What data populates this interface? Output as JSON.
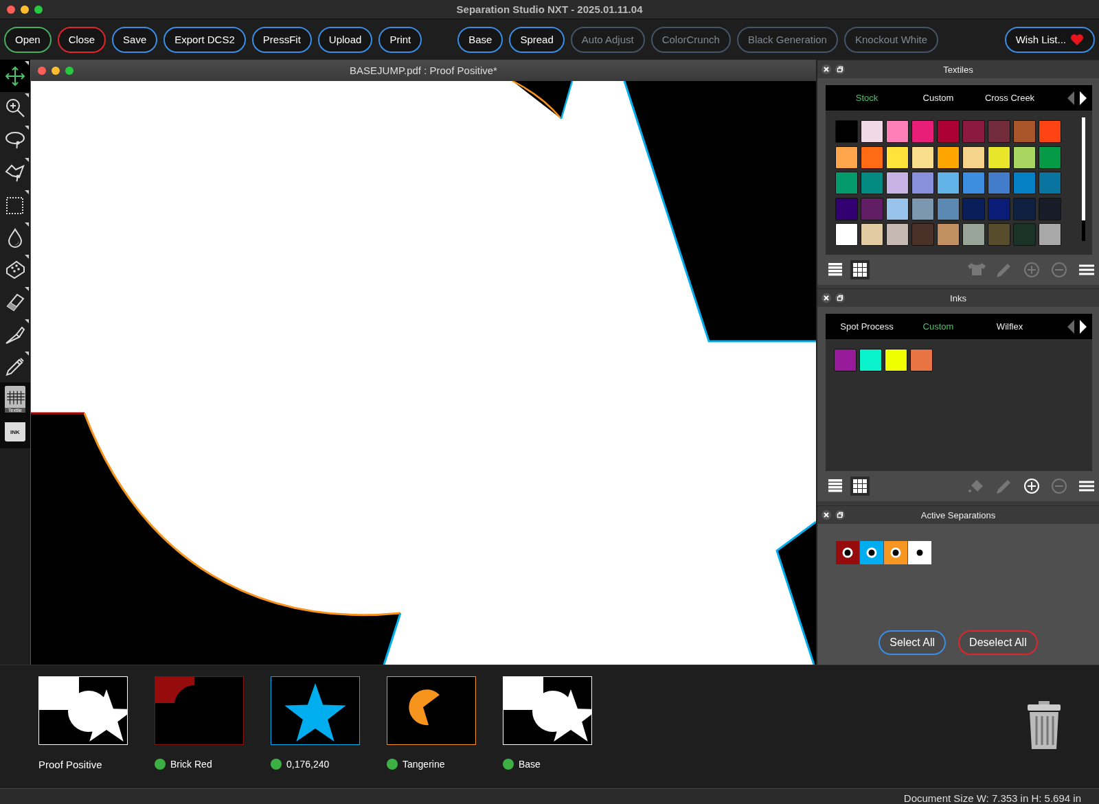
{
  "window": {
    "title": "Separation Studio NXT - 2025.01.11.04"
  },
  "toolbar": {
    "left": [
      {
        "label": "Open",
        "color": "#46b060",
        "disabled": false
      },
      {
        "label": "Close",
        "color": "#e0262b",
        "disabled": false
      },
      {
        "label": "Save",
        "color": "#3a8ee6",
        "disabled": false
      },
      {
        "label": "Export DCS2",
        "color": "#3a8ee6",
        "disabled": false
      },
      {
        "label": "PressFit",
        "color": "#3a8ee6",
        "disabled": false
      },
      {
        "label": "Upload",
        "color": "#3a8ee6",
        "disabled": false
      },
      {
        "label": "Print",
        "color": "#3a8ee6",
        "disabled": false
      }
    ],
    "middle": [
      {
        "label": "Base",
        "color": "#3a8ee6",
        "disabled": false
      },
      {
        "label": "Spread",
        "color": "#3a8ee6",
        "disabled": false
      },
      {
        "label": "Auto Adjust",
        "color": "#44546a",
        "disabled": true
      },
      {
        "label": "ColorCrunch",
        "color": "#44546a",
        "disabled": true
      },
      {
        "label": "Black Generation",
        "color": "#44546a",
        "disabled": true
      },
      {
        "label": "Knockout White",
        "color": "#44546a",
        "disabled": true
      }
    ],
    "right": [
      {
        "label": "Wish List...",
        "color": "#3a8ee6",
        "disabled": false
      }
    ]
  },
  "tools": [
    {
      "kind": "move",
      "selected": true
    },
    {
      "kind": "zoom",
      "selected": false
    },
    {
      "kind": "lasso",
      "selected": false
    },
    {
      "kind": "polygon-lasso",
      "selected": false
    },
    {
      "kind": "marquee",
      "selected": false
    },
    {
      "kind": "droplet",
      "selected": false
    },
    {
      "kind": "sponge",
      "selected": false
    },
    {
      "kind": "eraser",
      "selected": false
    },
    {
      "kind": "knife",
      "selected": false
    },
    {
      "kind": "pen",
      "selected": false
    },
    {
      "kind": "textile",
      "label": "Textile",
      "selected": false
    },
    {
      "kind": "ink",
      "label": "INK",
      "selected": false
    }
  ],
  "document": {
    "title": "BASEJUMP.pdf : Proof Positive*"
  },
  "textiles": {
    "title": "Textiles",
    "tabs": [
      {
        "label": "Stock",
        "selected": true
      },
      {
        "label": "Custom",
        "selected": false
      },
      {
        "label": "Cross Creek",
        "selected": false
      }
    ],
    "swatches": [
      {
        "color": "#000000"
      },
      {
        "color": "#f2d9e6"
      },
      {
        "color": "#ff80b8"
      },
      {
        "color": "#e91e78"
      },
      {
        "color": "#ad0032"
      },
      {
        "color": "#8b1a40"
      },
      {
        "color": "#722c3c"
      },
      {
        "color": "#a8562a"
      },
      {
        "color": "#ff4414"
      },
      {
        "color": "#ffa64d"
      },
      {
        "color": "#ff6a14"
      },
      {
        "color": "#ffe23a"
      },
      {
        "color": "#f9de8c"
      },
      {
        "color": "#ffa500"
      },
      {
        "color": "#f5d38a"
      },
      {
        "color": "#e8e52a"
      },
      {
        "color": "#a8d660"
      },
      {
        "color": "#049a46"
      },
      {
        "color": "#049a6a"
      },
      {
        "color": "#048a80"
      },
      {
        "color": "#c8b4e4"
      },
      {
        "color": "#8890dc"
      },
      {
        "color": "#62b4e8"
      },
      {
        "color": "#3e8ee0"
      },
      {
        "color": "#447ccc"
      },
      {
        "color": "#0580c4"
      },
      {
        "color": "#0a74a0"
      },
      {
        "color": "#320070"
      },
      {
        "color": "#621e64"
      },
      {
        "color": "#98c4ec"
      },
      {
        "color": "#7c98b0"
      },
      {
        "color": "#5c88b4"
      },
      {
        "color": "#0a1f5a"
      },
      {
        "color": "#081c78"
      },
      {
        "color": "#0e2140"
      },
      {
        "color": "#181c28"
      },
      {
        "color": "#ffffff"
      },
      {
        "color": "#e2caa2"
      },
      {
        "color": "#c6b8b2"
      },
      {
        "color": "#4a3228"
      },
      {
        "color": "#c09060"
      },
      {
        "color": "#98a498"
      },
      {
        "color": "#574c2c"
      },
      {
        "color": "#1a3228"
      },
      {
        "color": "#a8a8a8"
      }
    ],
    "views": [
      {
        "kind": "list",
        "selected": false
      },
      {
        "kind": "grid",
        "selected": true
      }
    ],
    "actions": [
      {
        "kind": "shirt",
        "disabled": true
      },
      {
        "kind": "pencil",
        "disabled": true
      },
      {
        "kind": "plus",
        "disabled": true
      },
      {
        "kind": "minus",
        "disabled": true
      },
      {
        "kind": "menu",
        "disabled": false
      }
    ]
  },
  "inks": {
    "title": "Inks",
    "tabs": [
      {
        "label": "Spot Process",
        "selected": false
      },
      {
        "label": "Custom",
        "selected": true
      },
      {
        "label": "Wilflex",
        "selected": false
      }
    ],
    "swatches": [
      {
        "color": "#961a9a"
      },
      {
        "color": "#0af2cc"
      },
      {
        "color": "#f0ff00"
      },
      {
        "color": "#e87444"
      }
    ],
    "views": [
      {
        "kind": "list",
        "selected": false
      },
      {
        "kind": "grid",
        "selected": true
      }
    ],
    "actions": [
      {
        "kind": "bucket",
        "disabled": true
      },
      {
        "kind": "pencil",
        "disabled": true
      },
      {
        "kind": "plus",
        "disabled": false
      },
      {
        "kind": "minus",
        "disabled": true
      },
      {
        "kind": "menu",
        "disabled": false
      }
    ]
  },
  "active_separations": {
    "title": "Active Separations",
    "swatches": [
      {
        "color": "#960c0c",
        "kind": "ring"
      },
      {
        "color": "#00aef0",
        "kind": "ring"
      },
      {
        "color": "#f79620",
        "kind": "ring"
      },
      {
        "color": "#ffffff",
        "kind": "dot"
      }
    ],
    "buttons": [
      {
        "label": "Select All",
        "color": "#3a8ee6"
      },
      {
        "label": "Deselect All",
        "color": "#e0262b"
      }
    ]
  },
  "separations": [
    {
      "label": "Proof Positive",
      "kind": "composite",
      "color": "#ffffff",
      "status": false
    },
    {
      "label": "Brick Red",
      "kind": "arc",
      "color": "#8a1010",
      "status": true
    },
    {
      "label": "0,176,240",
      "kind": "star",
      "color": "#00aef0",
      "status": true
    },
    {
      "label": "Tangerine",
      "kind": "pacman",
      "color": "#f7941d",
      "status": true
    },
    {
      "label": "Base",
      "kind": "composite",
      "color": "#ffffff",
      "status": true
    }
  ],
  "status_bar": {
    "text": "Document Size W: 7.353 in H: 5.694 in"
  }
}
